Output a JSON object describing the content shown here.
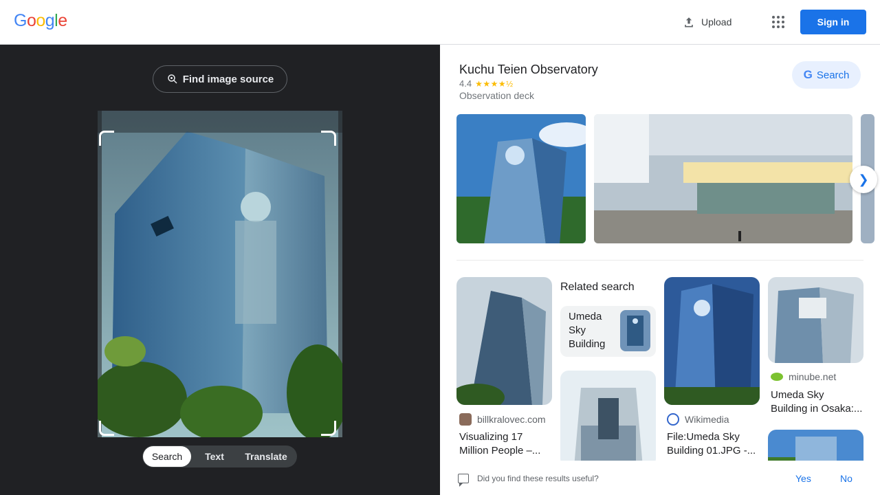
{
  "header": {
    "logo_letters": [
      "G",
      "o",
      "o",
      "g",
      "l",
      "e"
    ],
    "upload_label": "Upload",
    "apps_icon": "apps-grid-icon",
    "signin_label": "Sign in"
  },
  "lens": {
    "find_source_label": "Find image source",
    "modes": [
      "Search",
      "Text",
      "Translate"
    ],
    "active_mode": "Search"
  },
  "knowledge_panel": {
    "title": "Kuchu Teien Observatory",
    "rating": "4.4",
    "stars": "★★★★½",
    "type": "Observation deck",
    "search_label": "Search"
  },
  "related": {
    "heading": "Related search",
    "query": "Umeda Sky Building"
  },
  "results": [
    {
      "source": "billkralovec.com",
      "title_line1": "Visualizing 17",
      "title_line2": "Million People –..."
    },
    {
      "source": "Wikimedia",
      "title_line1": "File:Umeda Sky",
      "title_line2": "Building 01.JPG -..."
    },
    {
      "source": "minube.net",
      "title_line1": "Umeda Sky",
      "title_line2": "Building in Osaka:..."
    }
  ],
  "feedback": {
    "question": "Did you find these results useful?",
    "yes": "Yes",
    "no": "No"
  },
  "colors": {
    "accent": "#1a73e8",
    "dark_panel": "#202124"
  }
}
